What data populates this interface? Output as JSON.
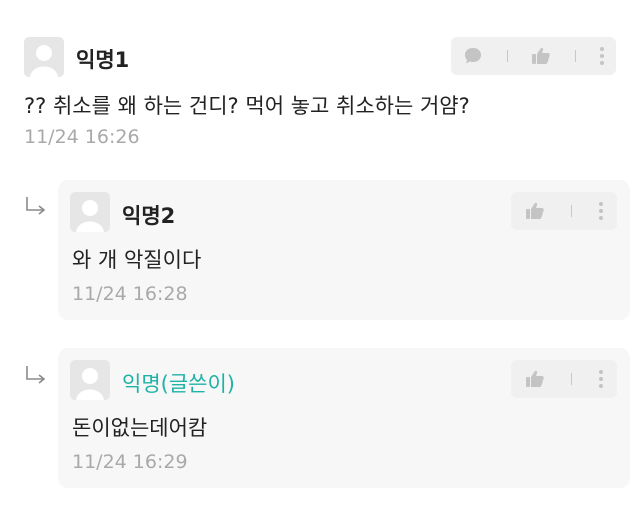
{
  "comments": [
    {
      "author": "익명1",
      "text": "?? 취소를 왜 하는 건디? 먹어 놓고 취소하는 거얌?",
      "time": "11/24 16:26"
    }
  ],
  "replies": [
    {
      "author": "익명2",
      "text": "와 개 악질이다",
      "time": "11/24 16:28"
    },
    {
      "author": "익명(글쓴이)",
      "text": "돈이없는데어캄",
      "time": "11/24 16:29",
      "author_color": "#1fb3a6"
    }
  ],
  "icons": {
    "avatar": "anonymous-avatar-icon",
    "reply_arrow": "reply-arrow-icon",
    "comment": "speech-bubble-icon",
    "like": "thumbs-up-icon",
    "more": "more-vertical-icon"
  },
  "colors": {
    "author_highlight": "#1fb3a6",
    "meta_text": "#a9a9a9",
    "reply_background": "#f7f7f7",
    "action_background": "#f0f0f0"
  }
}
